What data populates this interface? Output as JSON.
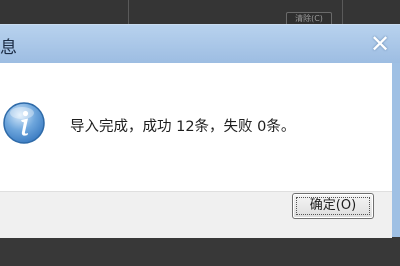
{
  "background": {
    "chip_text": "清除(C)"
  },
  "dialog": {
    "title": "息",
    "close_glyph": "✕",
    "message": "导入完成，成功 12条，失败 0条。",
    "ok_button_label": "确定(O)"
  },
  "colors": {
    "title_bar": "#9fc0e4",
    "icon_blue": "#3f7fc4"
  },
  "icons": {
    "message_icon": "information-icon",
    "close_icon": "close-icon"
  }
}
